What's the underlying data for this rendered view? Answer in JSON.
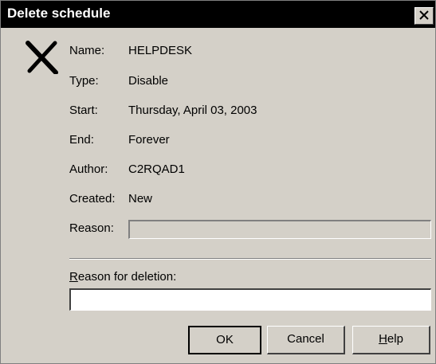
{
  "window": {
    "title": "Delete schedule",
    "close_icon": "close-icon",
    "status_icon": "delete-x-icon"
  },
  "fields": {
    "name": {
      "label": "Name:",
      "value": "HELPDESK"
    },
    "type": {
      "label": "Type:",
      "value": "Disable"
    },
    "start": {
      "label": "Start:",
      "value": "Thursday, April 03, 2003"
    },
    "end": {
      "label": "End:",
      "value": "Forever"
    },
    "author": {
      "label": "Author:",
      "value": "C2RQAD1"
    },
    "created": {
      "label": "Created:",
      "value": "New"
    },
    "reason": {
      "label": "Reason:",
      "value": ""
    }
  },
  "deletion": {
    "label_accel": "R",
    "label_rest": "eason for deletion:",
    "value": ""
  },
  "buttons": {
    "ok": "OK",
    "cancel": "Cancel",
    "help_accel": "H",
    "help_rest": "elp"
  }
}
